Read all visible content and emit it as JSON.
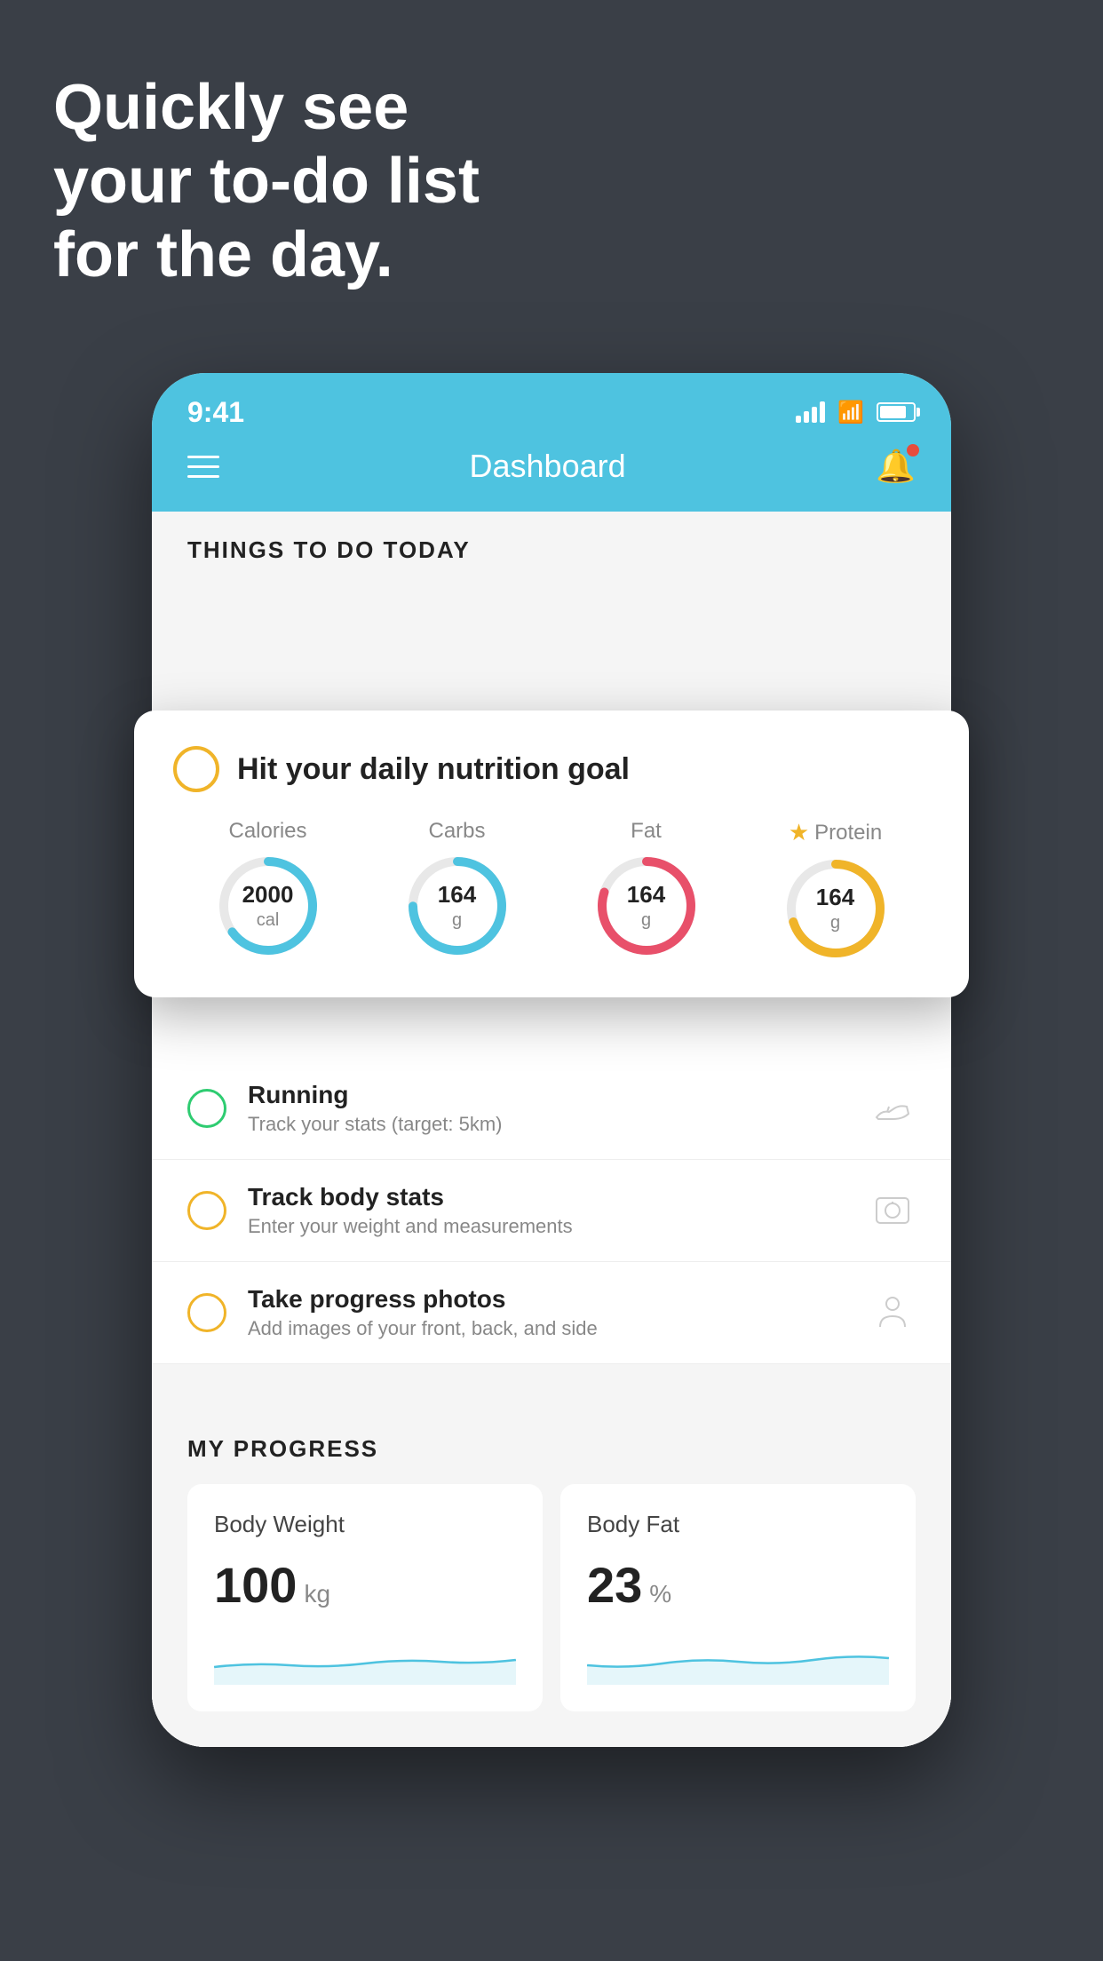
{
  "hero": {
    "line1": "Quickly see",
    "line2": "your to-do list",
    "line3": "for the day."
  },
  "statusBar": {
    "time": "9:41"
  },
  "header": {
    "title": "Dashboard"
  },
  "thingsToDo": {
    "sectionTitle": "THINGS TO DO TODAY",
    "nutritionCard": {
      "title": "Hit your daily nutrition goal",
      "items": [
        {
          "label": "Calories",
          "value": "2000",
          "unit": "cal",
          "color": "#4ec3e0",
          "pct": 65,
          "starred": false
        },
        {
          "label": "Carbs",
          "value": "164",
          "unit": "g",
          "color": "#4ec3e0",
          "pct": 75,
          "starred": false
        },
        {
          "label": "Fat",
          "value": "164",
          "unit": "g",
          "color": "#e8506a",
          "pct": 80,
          "starred": false
        },
        {
          "label": "Protein",
          "value": "164",
          "unit": "g",
          "color": "#f0b429",
          "pct": 70,
          "starred": true
        }
      ]
    },
    "todoItems": [
      {
        "title": "Running",
        "subtitle": "Track your stats (target: 5km)",
        "circleColor": "green",
        "icon": "shoe"
      },
      {
        "title": "Track body stats",
        "subtitle": "Enter your weight and measurements",
        "circleColor": "yellow",
        "icon": "scale"
      },
      {
        "title": "Take progress photos",
        "subtitle": "Add images of your front, back, and side",
        "circleColor": "yellow",
        "icon": "person"
      }
    ]
  },
  "progress": {
    "sectionTitle": "MY PROGRESS",
    "cards": [
      {
        "title": "Body Weight",
        "value": "100",
        "unit": "kg"
      },
      {
        "title": "Body Fat",
        "value": "23",
        "unit": "%"
      }
    ]
  }
}
